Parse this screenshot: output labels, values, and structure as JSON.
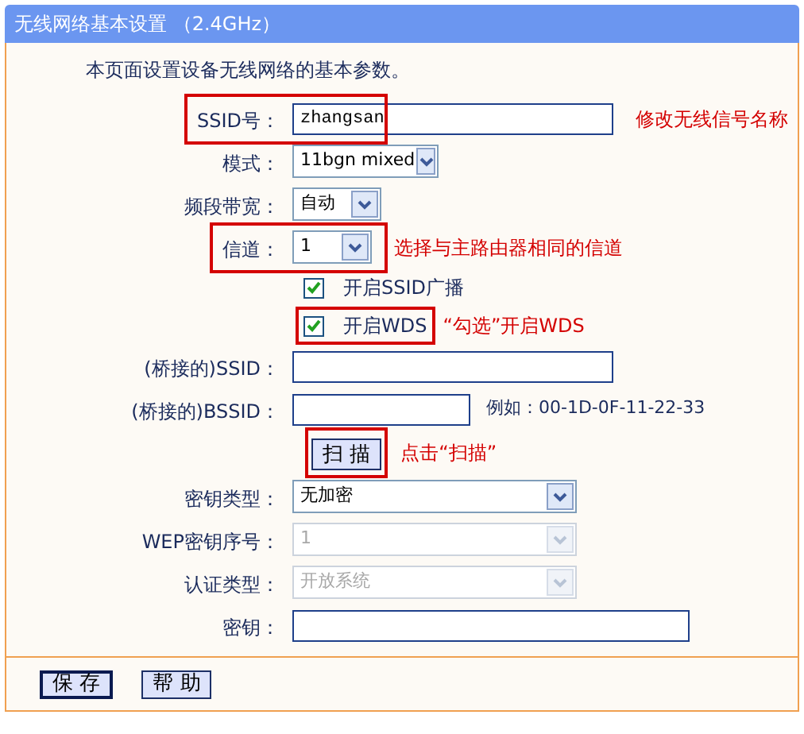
{
  "window": {
    "title": "无线网络基本设置 （2.4GHz）"
  },
  "intro": "本页面设置设备无线网络的基本参数。",
  "rows": [
    {
      "kind": "text",
      "label": "SSID号：",
      "value": "zhangsan",
      "highlighted": true,
      "note": "修改无线信号名称"
    },
    {
      "kind": "select",
      "label": "模式：",
      "value": "11bgn mixed",
      "disabled": false,
      "highlighted": false
    },
    {
      "kind": "select",
      "label": "频段带宽：",
      "value": "自动",
      "disabled": false,
      "highlighted": false
    },
    {
      "kind": "select",
      "label": "信道：",
      "value": "1",
      "disabled": false,
      "highlighted": true,
      "note": "选择与主路由器相同的信道"
    },
    {
      "kind": "checkbox",
      "text": "开启SSID广播",
      "checked": true,
      "highlighted": false
    },
    {
      "kind": "checkbox",
      "text": "开启WDS",
      "checked": true,
      "highlighted": true,
      "note": "“勾选”开启WDS"
    },
    {
      "kind": "text",
      "label": "(桥接的)SSID：",
      "value": "",
      "highlighted": false
    },
    {
      "kind": "text",
      "label": "(桥接的)BSSID：",
      "value": "",
      "highlighted": false,
      "hint": "例如：00-1D-0F-11-22-33"
    },
    {
      "kind": "button",
      "text": "扫 描",
      "highlighted": true,
      "note": "点击“扫描”"
    },
    {
      "kind": "select",
      "label": "密钥类型：",
      "value": "无加密",
      "disabled": false,
      "highlighted": false
    },
    {
      "kind": "select",
      "label": "WEP密钥序号：",
      "value": "1",
      "disabled": true,
      "highlighted": false
    },
    {
      "kind": "select",
      "label": "认证类型：",
      "value": "开放系统",
      "disabled": true,
      "highlighted": false
    },
    {
      "kind": "text",
      "label": "密钥：",
      "value": "",
      "highlighted": false
    }
  ],
  "buttons": [
    {
      "text": "保 存",
      "selected": true
    },
    {
      "text": "帮 助",
      "selected": false
    }
  ]
}
